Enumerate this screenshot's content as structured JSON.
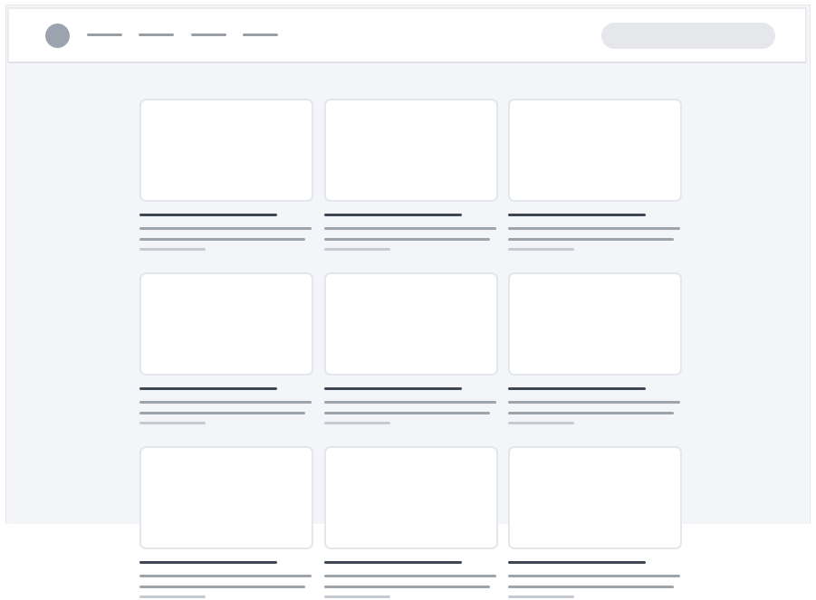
{
  "header": {
    "avatar_icon": "avatar",
    "nav_items": [
      {
        "name": "nav-item-1"
      },
      {
        "name": "nav-item-2"
      },
      {
        "name": "nav-item-3"
      },
      {
        "name": "nav-item-4"
      }
    ],
    "search": {
      "placeholder": ""
    }
  },
  "grid": {
    "rows": 3,
    "columns": 3,
    "cards": [
      {
        "id": 1
      },
      {
        "id": 2
      },
      {
        "id": 3
      },
      {
        "id": 4
      },
      {
        "id": 5
      },
      {
        "id": 6
      },
      {
        "id": 7
      },
      {
        "id": 8
      },
      {
        "id": 9
      }
    ]
  },
  "colors": {
    "background": "#f4f5f8",
    "card_border": "#e3e6ea",
    "title_line": "#3f4754",
    "body_line": "#9ea4ab",
    "meta_line": "#c6cbd1",
    "avatar": "#9ca3af",
    "search_fill": "#e5e7eb"
  }
}
